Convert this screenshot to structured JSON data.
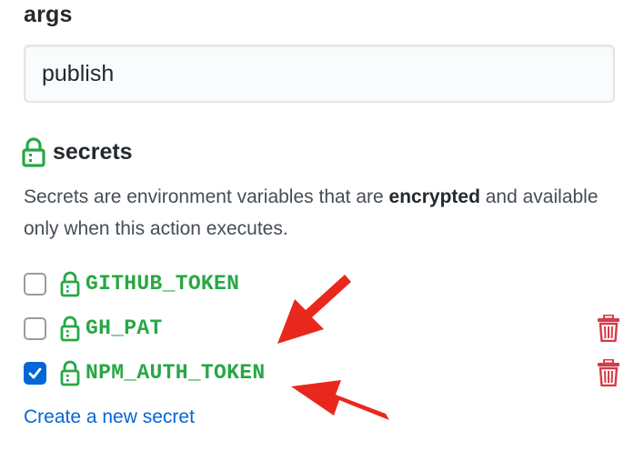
{
  "args": {
    "heading": "args",
    "value": "publish"
  },
  "secrets": {
    "heading": "secrets",
    "description_before": "Secrets are environment variables that are ",
    "description_bold": "encrypted",
    "description_after": " and available only when this action executes.",
    "items": [
      {
        "name": "GITHUB_TOKEN",
        "checked": false,
        "deletable": false
      },
      {
        "name": "GH_PAT",
        "checked": false,
        "deletable": true
      },
      {
        "name": "NPM_AUTH_TOKEN",
        "checked": true,
        "deletable": true
      }
    ],
    "create_link": "Create a new secret"
  },
  "icons": {
    "lock": "lock-icon",
    "trash": "trash-icon",
    "check": "check-icon",
    "arrow": "red-arrow-annotation"
  },
  "colors": {
    "secret_green": "#28a745",
    "link_blue": "#0366d6",
    "trash_red": "#d73a49",
    "arrow_red": "#e8281c",
    "checkbox_checked": "#0366d6"
  }
}
